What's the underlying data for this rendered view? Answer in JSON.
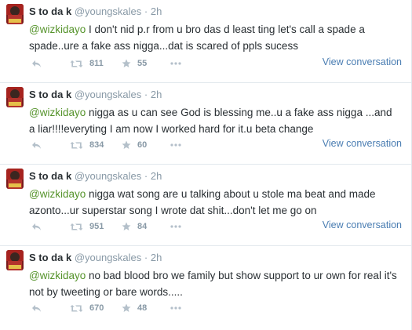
{
  "tweets": [
    {
      "name": "S to da k",
      "handle": "@youngskales",
      "separator": "·",
      "time": "2h",
      "mention": "@wizkidayo",
      "text": " I don't nid p.r from u bro das d least ting let's call a spade a spade..ure a fake ass nigga...dat is scared of ppls sucess",
      "retweets": "811",
      "favorites": "55",
      "view_label": "View conversation"
    },
    {
      "name": "S to da k",
      "handle": "@youngskales",
      "separator": "·",
      "time": "2h",
      "mention": "@wizkidayo",
      "text": " nigga as u can see God is blessing me..u a fake ass nigga ...and a liar!!!!everyting I am now I worked hard for it.u beta change",
      "retweets": "834",
      "favorites": "60",
      "view_label": "View conversation"
    },
    {
      "name": "S to da k",
      "handle": "@youngskales",
      "separator": "·",
      "time": "2h",
      "mention": "@wizkidayo",
      "text": " nigga wat song are u talking about u stole ma beat and made azonto...ur superstar song I wrote dat shit...don't let me go on",
      "retweets": "951",
      "favorites": "84",
      "view_label": "View conversation"
    },
    {
      "name": "S to da k",
      "handle": "@youngskales",
      "separator": "·",
      "time": "2h",
      "mention": "@wizkidayo",
      "text": " no bad blood bro we family but show support to ur own for real it's not by tweeting or bare words.....",
      "retweets": "670",
      "favorites": "48",
      "view_label": ""
    }
  ],
  "icons": {
    "reply": "reply-icon",
    "retweet": "retweet-icon",
    "favorite": "star-icon",
    "more": "more-icon"
  },
  "colors": {
    "mention": "#55932b",
    "link": "#4a7db2",
    "muted": "#8899a6"
  }
}
